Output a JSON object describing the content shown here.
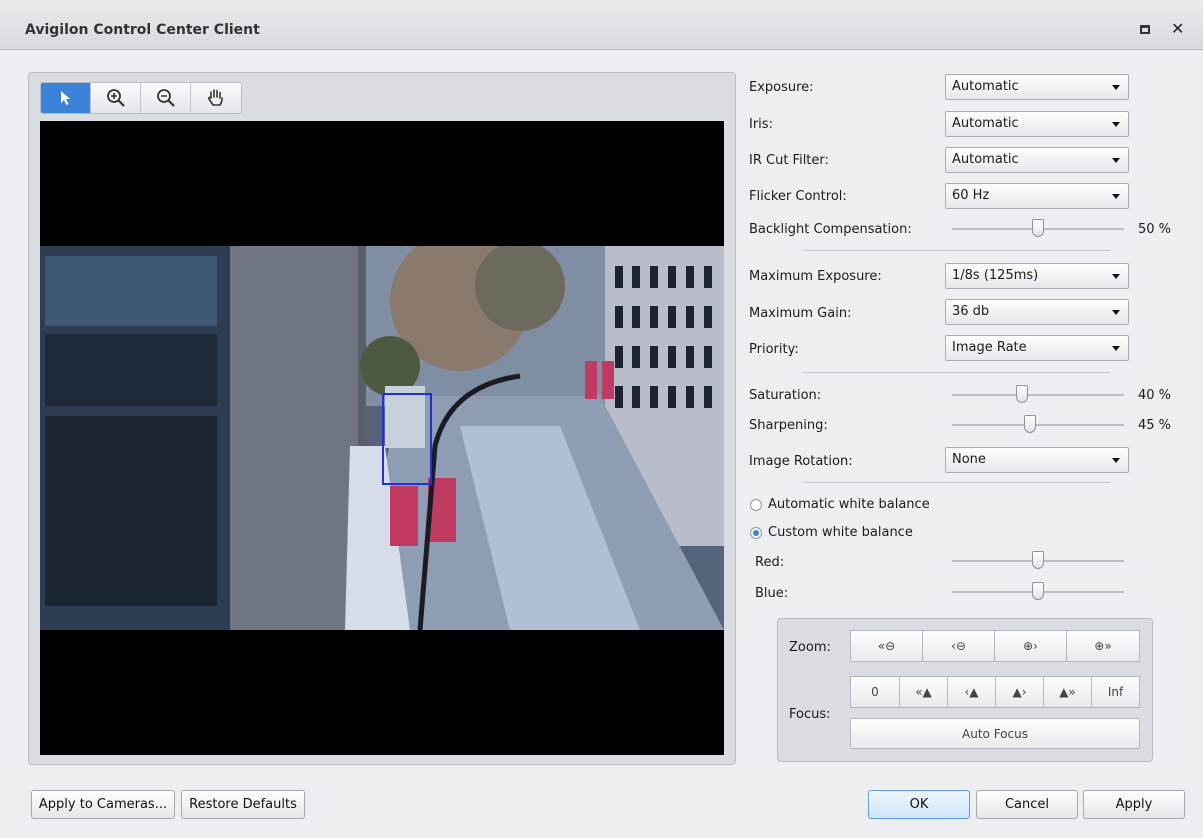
{
  "window": {
    "title": "Avigilon Control Center Client"
  },
  "toolbar": {
    "tools": [
      "pointer-icon",
      "zoom-in-icon",
      "zoom-out-icon",
      "pan-hand-icon"
    ]
  },
  "settings": {
    "exposure": {
      "label": "Exposure:",
      "value": "Automatic"
    },
    "iris": {
      "label": "Iris:",
      "value": "Automatic"
    },
    "ir_cut_filter": {
      "label": "IR Cut Filter:",
      "value": "Automatic"
    },
    "flicker_control": {
      "label": "Flicker Control:",
      "value": "60 Hz"
    },
    "backlight_compensation": {
      "label": "Backlight Compensation:",
      "value": 50,
      "display": "50 %"
    },
    "maximum_exposure": {
      "label": "Maximum Exposure:",
      "value": "1/8s (125ms)"
    },
    "maximum_gain": {
      "label": "Maximum Gain:",
      "value": "36 db"
    },
    "priority": {
      "label": "Priority:",
      "value": "Image Rate"
    },
    "saturation": {
      "label": "Saturation:",
      "value": 40,
      "display": "40 %"
    },
    "sharpening": {
      "label": "Sharpening:",
      "value": 45,
      "display": "45 %"
    },
    "image_rotation": {
      "label": "Image Rotation:",
      "value": "None"
    }
  },
  "white_balance": {
    "automatic_label": "Automatic white balance",
    "custom_label": "Custom white balance",
    "selected": "custom",
    "red": {
      "label": "Red:",
      "value": 50
    },
    "blue": {
      "label": "Blue:",
      "value": 50
    }
  },
  "ptz": {
    "zoom_label": "Zoom:",
    "focus_label": "Focus:",
    "focus_zero": "0",
    "focus_inf": "Inf",
    "auto_focus": "Auto Focus"
  },
  "footer": {
    "apply_to_cameras": "Apply to Cameras...",
    "restore_defaults": "Restore Defaults",
    "ok": "OK",
    "cancel": "Cancel",
    "apply": "Apply"
  },
  "colors": {
    "accent": "#3b82d9",
    "selection_box": "#2030e0"
  }
}
